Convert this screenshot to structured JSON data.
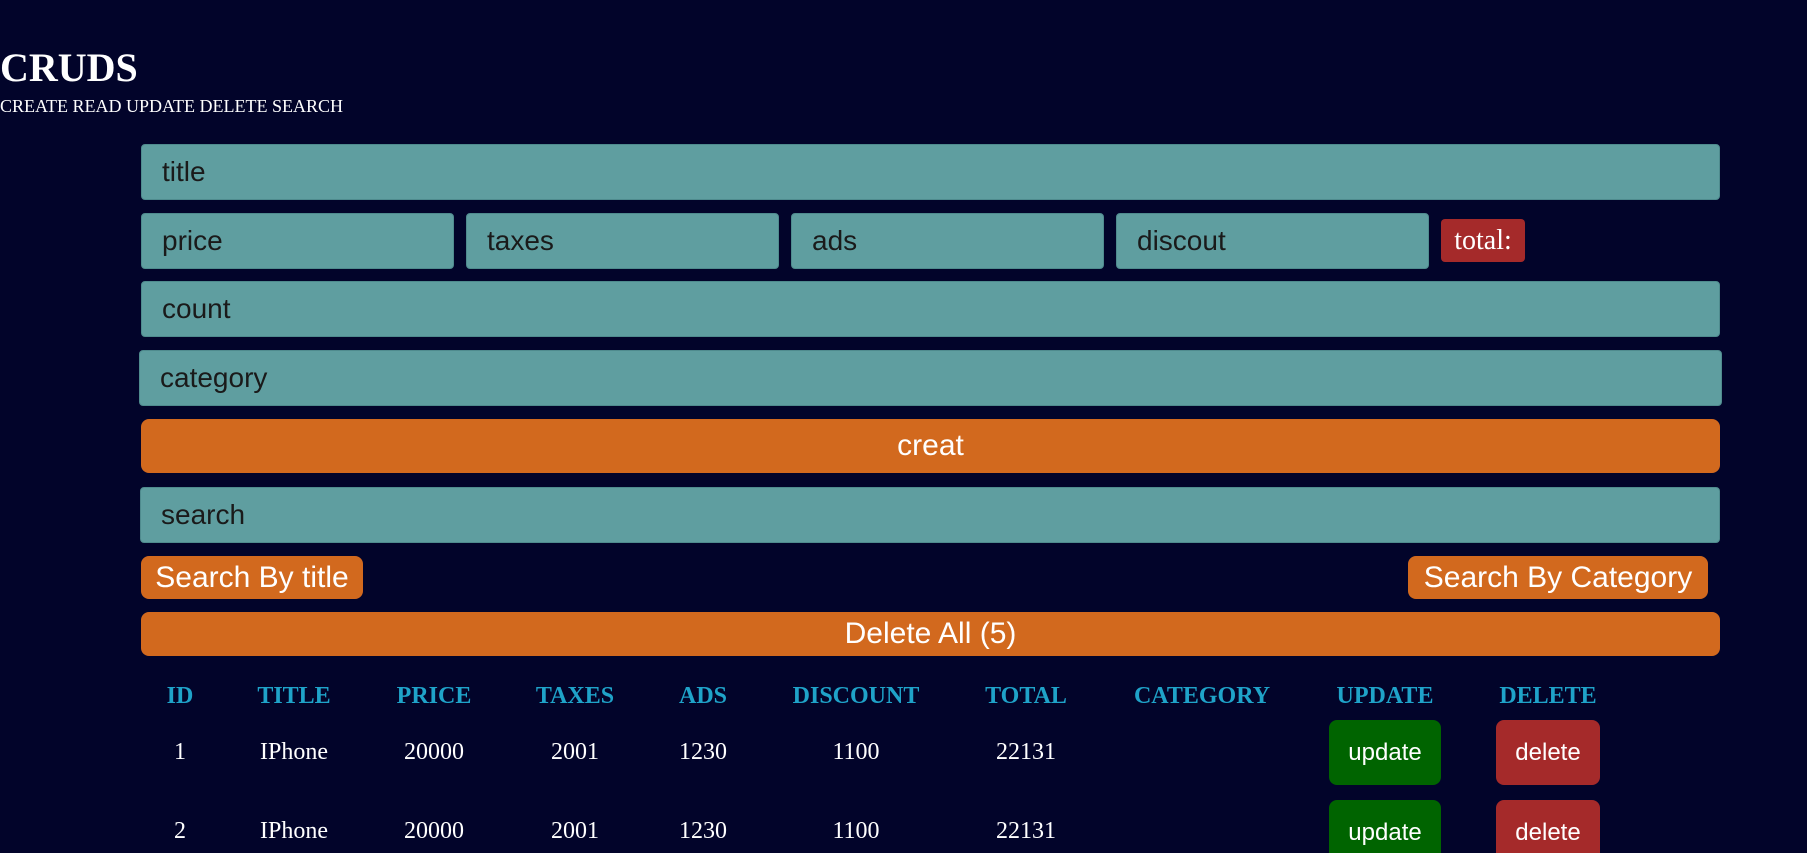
{
  "header": {
    "title": "CRUDS",
    "subtitle": "CREATE READ UPDATE DELETE SEARCH"
  },
  "form": {
    "title_placeholder": "title",
    "price_placeholder": "price",
    "taxes_placeholder": "taxes",
    "ads_placeholder": "ads",
    "discount_placeholder": "discout",
    "total_label": "total:",
    "count_placeholder": "count",
    "category_placeholder": "category",
    "create_label": "creat"
  },
  "search": {
    "placeholder": "search",
    "by_title_label": "Search By title",
    "by_category_label": "Search By Category"
  },
  "delete_all_label": "Delete All (5)",
  "table": {
    "headers": [
      "ID",
      "TITLE",
      "PRICE",
      "TAXES",
      "ADS",
      "DISCOUNT",
      "TOTAL",
      "CATEGORY",
      "UPDATE",
      "DELETE"
    ],
    "rows": [
      {
        "id": "1",
        "title": "IPhone",
        "price": "20000",
        "taxes": "2001",
        "ads": "1230",
        "discount": "1100",
        "total": "22131",
        "category": "",
        "update_label": "update",
        "delete_label": "delete"
      },
      {
        "id": "2",
        "title": "IPhone",
        "price": "20000",
        "taxes": "2001",
        "ads": "1230",
        "discount": "1100",
        "total": "22131",
        "category": "",
        "update_label": "update",
        "delete_label": "delete"
      }
    ]
  },
  "colors": {
    "background": "#02042a",
    "input": "#5f9ea0",
    "accent_orange": "#d2691e",
    "danger": "#a52a2a",
    "success": "#006400",
    "table_header": "#1fa3c9"
  }
}
